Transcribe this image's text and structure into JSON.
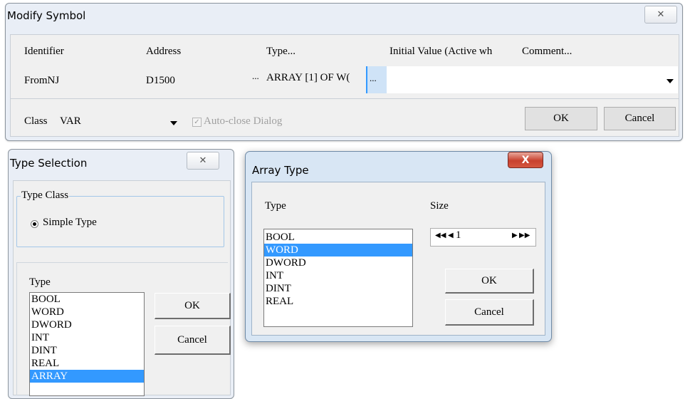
{
  "modify_symbol": {
    "title": "Modify Symbol",
    "close_glyph": "✕",
    "headers": {
      "identifier": "Identifier",
      "address": "Address",
      "type": "Type...",
      "initial_value": "Initial Value (Active wh",
      "comment": "Comment..."
    },
    "row": {
      "identifier": "FromNJ",
      "address": "D1500",
      "ellipsis1": "...",
      "type": "ARRAY [1] OF W(",
      "ellipsis2": "..."
    },
    "class_label": "Class",
    "class_value": "VAR",
    "autoclose_label": "Auto-close Dialog",
    "ok_label": "OK",
    "cancel_label": "Cancel"
  },
  "type_selection": {
    "title": "Type Selection",
    "close_glyph": "✕",
    "type_class_label": "Type Class",
    "simple_type_label": "Simple Type",
    "type_label": "Type",
    "items": [
      "BOOL",
      "WORD",
      "DWORD",
      "INT",
      "DINT",
      "REAL",
      "ARRAY"
    ],
    "ok_label": "OK",
    "cancel_label": "Cancel"
  },
  "array_type": {
    "title": "Array Type",
    "close_glyph": "X",
    "type_label": "Type",
    "size_label": "Size",
    "items": [
      "BOOL",
      "WORD",
      "DWORD",
      "INT",
      "DINT",
      "REAL"
    ],
    "selected_item": "WORD",
    "size_value": "1",
    "ok_label": "OK",
    "cancel_label": "Cancel"
  },
  "colors": {
    "selection": "#3399ff",
    "window_frame": "#e9eef6",
    "close_red": "#c8412e"
  }
}
